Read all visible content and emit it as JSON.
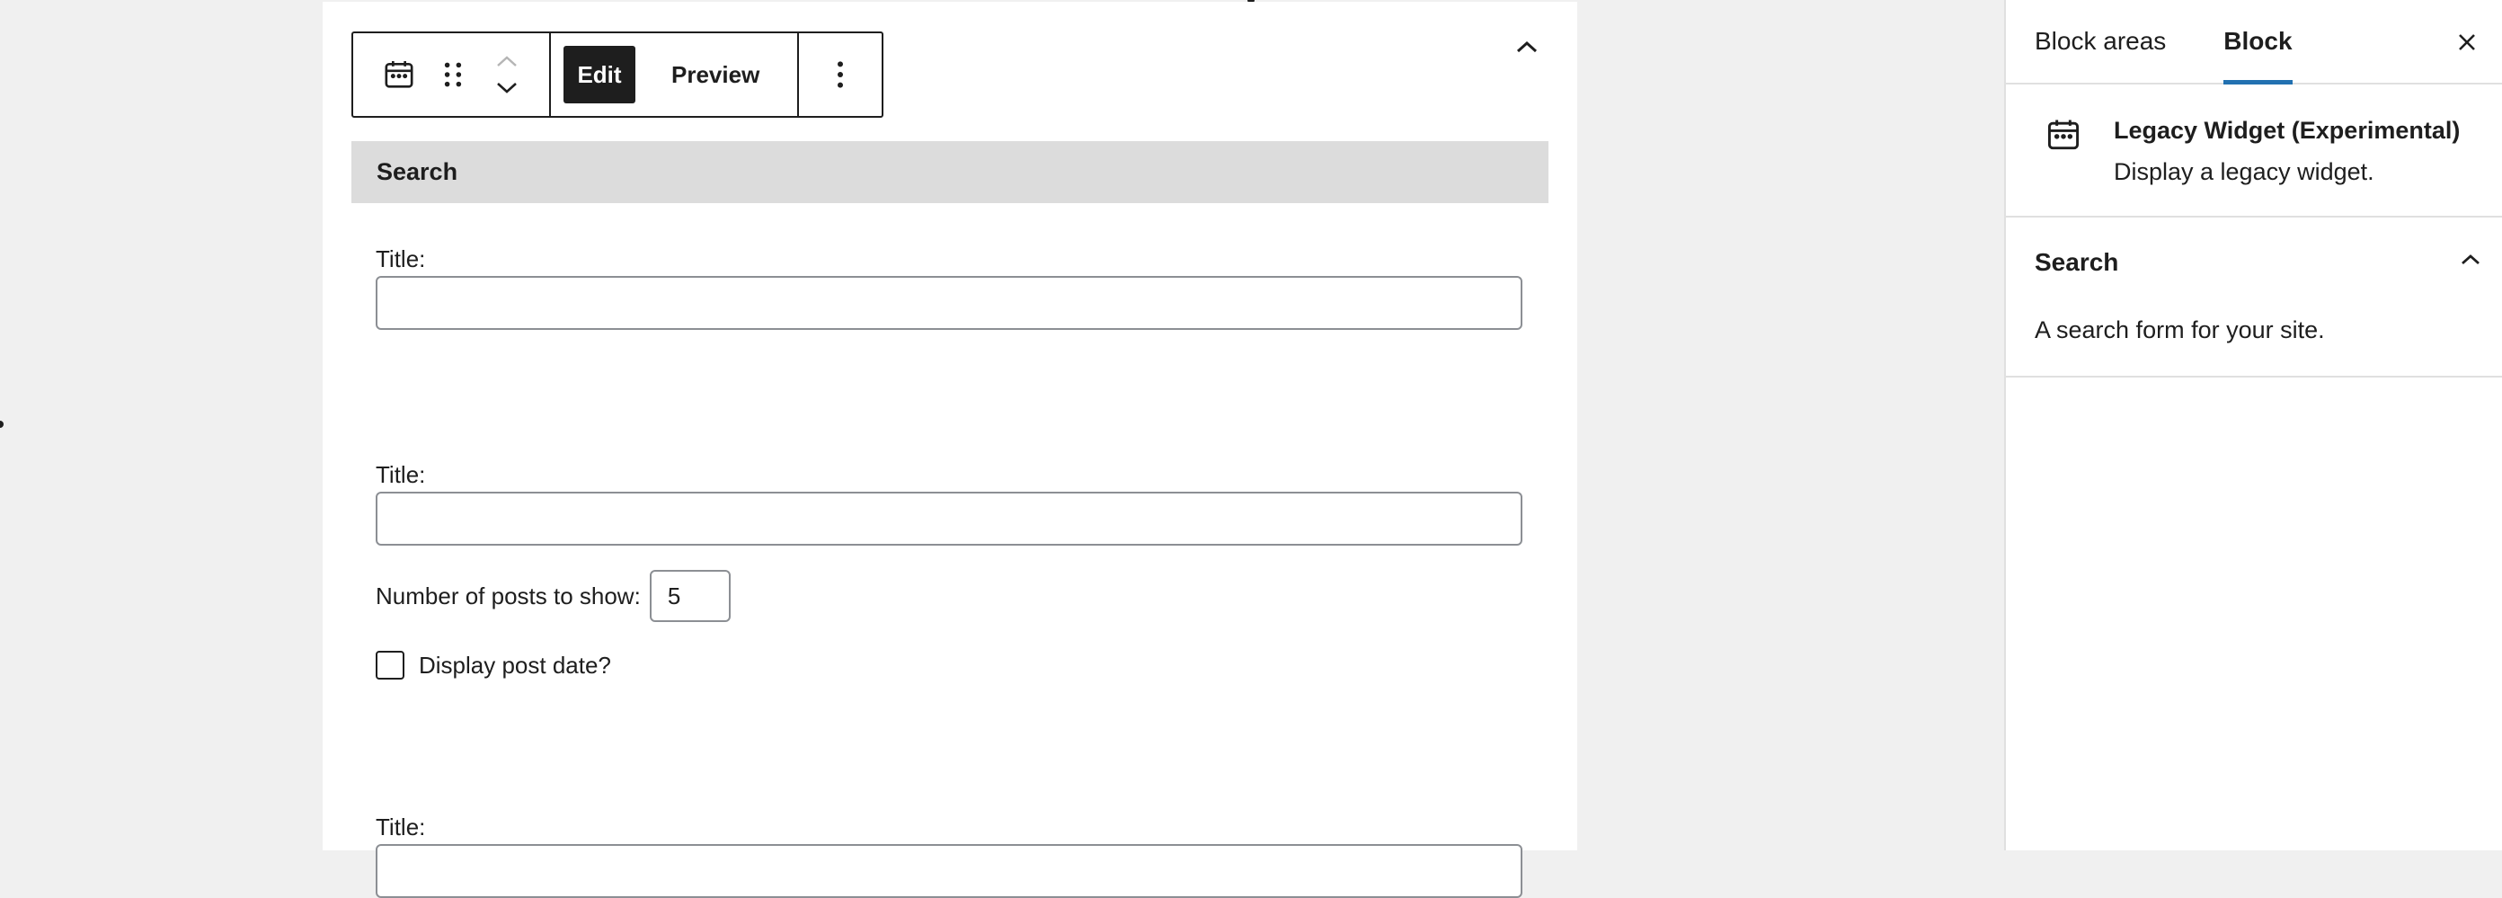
{
  "toolbar": {
    "edit_label": "Edit",
    "preview_label": "Preview",
    "block_icon": "calendar-icon",
    "drag_icon": "drag-handle-icon",
    "move_up_icon": "chevron-up-icon",
    "move_down_icon": "chevron-down-icon",
    "more_icon": "more-vertical-icon"
  },
  "widget": {
    "header": "Search",
    "fields": [
      {
        "label": "Title:",
        "value": ""
      },
      {
        "label": "Title:",
        "value": ""
      },
      {
        "label": "Title:",
        "value": ""
      }
    ],
    "posts_label": "Number of posts to show:",
    "posts_value": "5",
    "date_label": "Display post date?",
    "date_checked": false
  },
  "sidebar": {
    "tabs": [
      "Block areas",
      "Block"
    ],
    "active_tab": "Block",
    "block_title": "Legacy Widget (Experimental)",
    "block_desc": "Display a legacy widget.",
    "panel_title": "Search",
    "panel_desc": "A search form for your site."
  },
  "colors": {
    "accent": "#2271b1",
    "dark": "#1e1e1e",
    "canvas": "#f0f0f0",
    "widget_header": "#dcdcdc"
  }
}
